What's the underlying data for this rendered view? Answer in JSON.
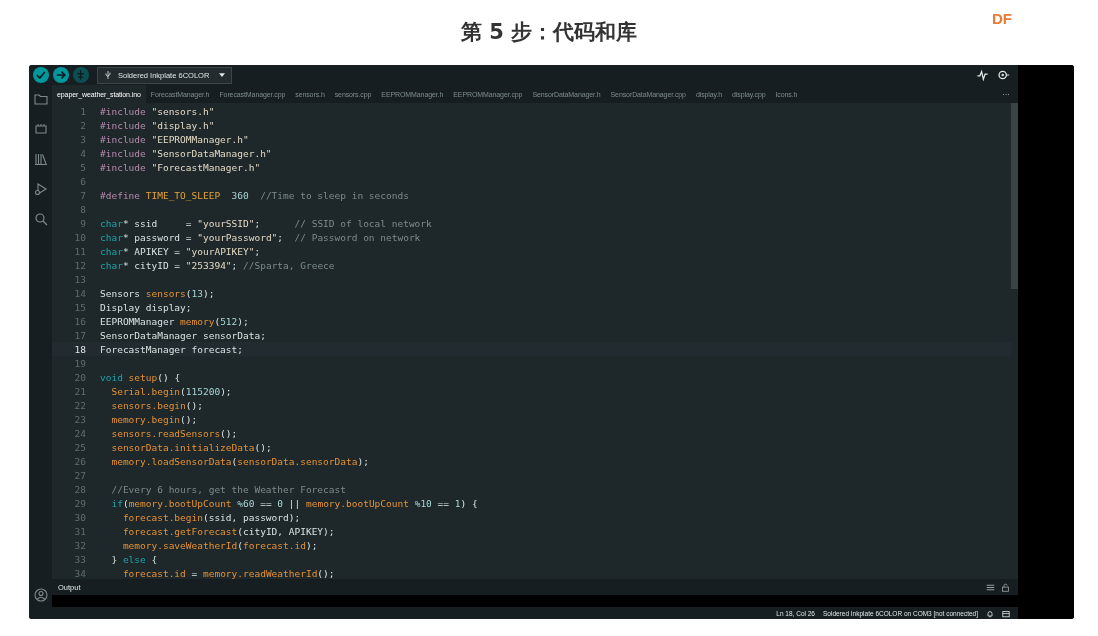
{
  "page": {
    "title": "第 5 步：代码和库",
    "logo": "DF"
  },
  "toolbar": {
    "buttons": [
      {
        "kind": "verify",
        "disabled": false
      },
      {
        "kind": "upload",
        "disabled": false
      },
      {
        "kind": "debug",
        "disabled": true
      }
    ],
    "board": "Soldered Inkplate 6COLOR"
  },
  "tabs": [
    {
      "label": "epaper_weather_station.ino",
      "selected": true
    },
    {
      "label": "ForecastManager.h",
      "selected": false
    },
    {
      "label": "ForecastManager.cpp",
      "selected": false
    },
    {
      "label": "sensors.h",
      "selected": false
    },
    {
      "label": "sensors.cpp",
      "selected": false
    },
    {
      "label": "EEPROMManager.h",
      "selected": false
    },
    {
      "label": "EEPROMManager.cpp",
      "selected": false
    },
    {
      "label": "SensorDataManager.h",
      "selected": false
    },
    {
      "label": "SensorDataManager.cpp",
      "selected": false
    },
    {
      "label": "display.h",
      "selected": false
    },
    {
      "label": "display.cpp",
      "selected": false
    },
    {
      "label": "Icons.h",
      "selected": false
    }
  ],
  "tabs_more": "···",
  "editor": {
    "lines": [
      {
        "number": "1",
        "current": false,
        "tokens": [
          {
            "kind": "directive",
            "text": "#include "
          },
          {
            "kind": "string",
            "text": "\"sensors.h\""
          }
        ]
      },
      {
        "number": "2",
        "current": false,
        "tokens": [
          {
            "kind": "directive",
            "text": "#include "
          },
          {
            "kind": "string",
            "text": "\"display.h\""
          }
        ]
      },
      {
        "number": "3",
        "current": false,
        "tokens": [
          {
            "kind": "directive",
            "text": "#include "
          },
          {
            "kind": "string",
            "text": "\"EEPROMManager.h\""
          }
        ]
      },
      {
        "number": "4",
        "current": false,
        "tokens": [
          {
            "kind": "directive",
            "text": "#include "
          },
          {
            "kind": "string",
            "text": "\"SensorDataManager.h\""
          }
        ]
      },
      {
        "number": "5",
        "current": false,
        "tokens": [
          {
            "kind": "directive",
            "text": "#include "
          },
          {
            "kind": "string",
            "text": "\"ForecastManager.h\""
          }
        ]
      },
      {
        "number": "6",
        "current": false
      },
      {
        "number": "7",
        "current": false,
        "tokens": [
          {
            "kind": "directive",
            "text": "#define "
          },
          {
            "kind": "macro",
            "text": "TIME_TO_SLEEP  "
          },
          {
            "kind": "number",
            "text": "360  "
          },
          {
            "kind": "comment",
            "text": "//Time to sleep in seconds"
          }
        ]
      },
      {
        "number": "8",
        "current": false
      },
      {
        "number": "9",
        "current": false,
        "tokens": [
          {
            "kind": "keyword",
            "text": "char"
          },
          {
            "kind": "plain",
            "text": "* ssid     = "
          },
          {
            "kind": "string",
            "text": "\"yourSSID\""
          },
          {
            "kind": "plain",
            "text": ";      "
          },
          {
            "kind": "comment",
            "text": "// SSID of local network"
          }
        ]
      },
      {
        "number": "10",
        "current": false,
        "tokens": [
          {
            "kind": "keyword",
            "text": "char"
          },
          {
            "kind": "plain",
            "text": "* password = "
          },
          {
            "kind": "string",
            "text": "\"yourPassword\""
          },
          {
            "kind": "plain",
            "text": ";  "
          },
          {
            "kind": "comment",
            "text": "// Password on network"
          }
        ]
      },
      {
        "number": "11",
        "current": false,
        "tokens": [
          {
            "kind": "keyword",
            "text": "char"
          },
          {
            "kind": "plain",
            "text": "* APIKEY = "
          },
          {
            "kind": "string",
            "text": "\"yourAPIKEY\""
          },
          {
            "kind": "plain",
            "text": ";"
          }
        ]
      },
      {
        "number": "12",
        "current": false,
        "tokens": [
          {
            "kind": "keyword",
            "text": "char"
          },
          {
            "kind": "plain",
            "text": "* cityID = "
          },
          {
            "kind": "string",
            "text": "\"253394\""
          },
          {
            "kind": "plain",
            "text": "; "
          },
          {
            "kind": "comment",
            "text": "//Sparta, Greece"
          }
        ]
      },
      {
        "number": "13",
        "current": false
      },
      {
        "number": "14",
        "current": false,
        "tokens": [
          {
            "kind": "plain",
            "text": "Sensors "
          },
          {
            "kind": "call",
            "text": "sensors"
          },
          {
            "kind": "plain",
            "text": "("
          },
          {
            "kind": "number",
            "text": "13"
          },
          {
            "kind": "plain",
            "text": ");"
          }
        ]
      },
      {
        "number": "15",
        "current": false,
        "tokens": [
          {
            "kind": "plain",
            "text": "Display display;"
          }
        ]
      },
      {
        "number": "16",
        "current": false,
        "tokens": [
          {
            "kind": "plain",
            "text": "EEPROMManager "
          },
          {
            "kind": "call",
            "text": "memory"
          },
          {
            "kind": "plain",
            "text": "("
          },
          {
            "kind": "number",
            "text": "512"
          },
          {
            "kind": "plain",
            "text": ");"
          }
        ]
      },
      {
        "number": "17",
        "current": false,
        "tokens": [
          {
            "kind": "plain",
            "text": "SensorDataManager sensorData;"
          }
        ]
      },
      {
        "number": "18",
        "current": true,
        "tokens": [
          {
            "kind": "plain",
            "text": "ForecastManager forecast;"
          }
        ]
      },
      {
        "number": "19",
        "current": false
      },
      {
        "number": "20",
        "current": false,
        "tokens": [
          {
            "kind": "keyword",
            "text": "void "
          },
          {
            "kind": "call",
            "text": "setup"
          },
          {
            "kind": "plain",
            "text": "() {"
          }
        ]
      },
      {
        "number": "21",
        "current": false,
        "tokens": [
          {
            "kind": "call",
            "text": "  Serial.begin"
          },
          {
            "kind": "plain",
            "text": "("
          },
          {
            "kind": "number",
            "text": "115200"
          },
          {
            "kind": "plain",
            "text": ");"
          }
        ]
      },
      {
        "number": "22",
        "current": false,
        "tokens": [
          {
            "kind": "call",
            "text": "  sensors.begin"
          },
          {
            "kind": "plain",
            "text": "();"
          }
        ]
      },
      {
        "number": "23",
        "current": false,
        "tokens": [
          {
            "kind": "call",
            "text": "  memory.begin"
          },
          {
            "kind": "plain",
            "text": "();"
          }
        ]
      },
      {
        "number": "24",
        "current": false,
        "tokens": [
          {
            "kind": "call",
            "text": "  sensors.readSensors"
          },
          {
            "kind": "plain",
            "text": "();"
          }
        ]
      },
      {
        "number": "25",
        "current": false,
        "tokens": [
          {
            "kind": "call",
            "text": "  sensorData.initializeData"
          },
          {
            "kind": "plain",
            "text": "();"
          }
        ]
      },
      {
        "number": "26",
        "current": false,
        "tokens": [
          {
            "kind": "call",
            "text": "  memory.loadSensorData"
          },
          {
            "kind": "plain",
            "text": "("
          },
          {
            "kind": "call",
            "text": "sensorData.sensorData"
          },
          {
            "kind": "plain",
            "text": ");"
          }
        ]
      },
      {
        "number": "27",
        "current": false
      },
      {
        "number": "28",
        "current": false,
        "tokens": [
          {
            "kind": "comment",
            "text": "  //Every 6 hours, get the Weather Forecast"
          }
        ]
      },
      {
        "number": "29",
        "current": false,
        "tokens": [
          {
            "kind": "keyword",
            "text": "  if"
          },
          {
            "kind": "plain",
            "text": "("
          },
          {
            "kind": "call",
            "text": "memory.bootUpCount "
          },
          {
            "kind": "number",
            "text": "%60"
          },
          {
            "kind": "plain",
            "text": " == "
          },
          {
            "kind": "number",
            "text": "0"
          },
          {
            "kind": "plain",
            "text": " || "
          },
          {
            "kind": "call",
            "text": "memory.bootUpCount "
          },
          {
            "kind": "number",
            "text": "%10"
          },
          {
            "kind": "plain",
            "text": " == "
          },
          {
            "kind": "number",
            "text": "1"
          },
          {
            "kind": "plain",
            "text": ") {"
          }
        ]
      },
      {
        "number": "30",
        "current": false,
        "tokens": [
          {
            "kind": "call",
            "text": "    forecast.begin"
          },
          {
            "kind": "plain",
            "text": "(ssid, password);"
          }
        ]
      },
      {
        "number": "31",
        "current": false,
        "tokens": [
          {
            "kind": "call",
            "text": "    forecast.getForecast"
          },
          {
            "kind": "plain",
            "text": "(cityID, APIKEY);"
          }
        ]
      },
      {
        "number": "32",
        "current": false,
        "tokens": [
          {
            "kind": "call",
            "text": "    memory.saveWeatherId"
          },
          {
            "kind": "plain",
            "text": "("
          },
          {
            "kind": "call",
            "text": "forecast.id"
          },
          {
            "kind": "plain",
            "text": ");"
          }
        ]
      },
      {
        "number": "33",
        "current": false,
        "tokens": [
          {
            "kind": "plain",
            "text": "  } "
          },
          {
            "kind": "keyword",
            "text": "else"
          },
          {
            "kind": "plain",
            "text": " {"
          }
        ]
      },
      {
        "number": "34",
        "current": false,
        "tokens": [
          {
            "kind": "call",
            "text": "    forecast.id"
          },
          {
            "kind": "plain",
            "text": " = "
          },
          {
            "kind": "call",
            "text": "memory.readWeatherId"
          },
          {
            "kind": "plain",
            "text": "();"
          }
        ]
      }
    ]
  },
  "output": {
    "title": "Output"
  },
  "status_bar": {
    "position": "Ln 18, Col 26",
    "board": "Soldered Inkplate 6COLOR on COM3 [not connected]"
  }
}
